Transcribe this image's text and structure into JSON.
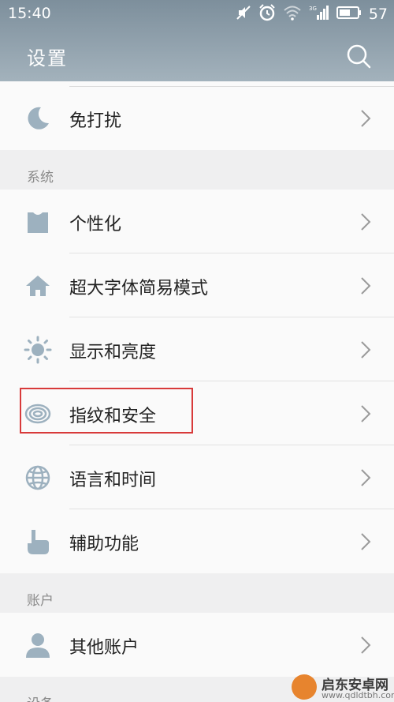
{
  "status_bar": {
    "time": "15:40",
    "network": "3G",
    "battery_percent": "57"
  },
  "header": {
    "title": "设置",
    "search_icon": "search-icon"
  },
  "sections": {
    "top": {
      "items": [
        {
          "label": "免打扰",
          "icon": "moon-icon"
        }
      ]
    },
    "system": {
      "header": "系统",
      "items": [
        {
          "label": "个性化",
          "icon": "shirt-icon"
        },
        {
          "label": "超大字体简易模式",
          "icon": "home-icon"
        },
        {
          "label": "显示和亮度",
          "icon": "sun-icon"
        },
        {
          "label": "指纹和安全",
          "icon": "fingerprint-icon"
        },
        {
          "label": "语言和时间",
          "icon": "globe-icon"
        },
        {
          "label": "辅助功能",
          "icon": "hand-pointer-icon"
        }
      ]
    },
    "accounts": {
      "header": "账户",
      "items": [
        {
          "label": "其他账户",
          "icon": "user-icon"
        }
      ]
    },
    "devices": {
      "header": "设备"
    }
  },
  "watermark": {
    "name": "启东安卓网",
    "url": "www.qdldtbh.com"
  },
  "colors": {
    "topbar": "#8b9ba6",
    "icon": "#9db1bf",
    "highlight": "#d83a3a"
  }
}
